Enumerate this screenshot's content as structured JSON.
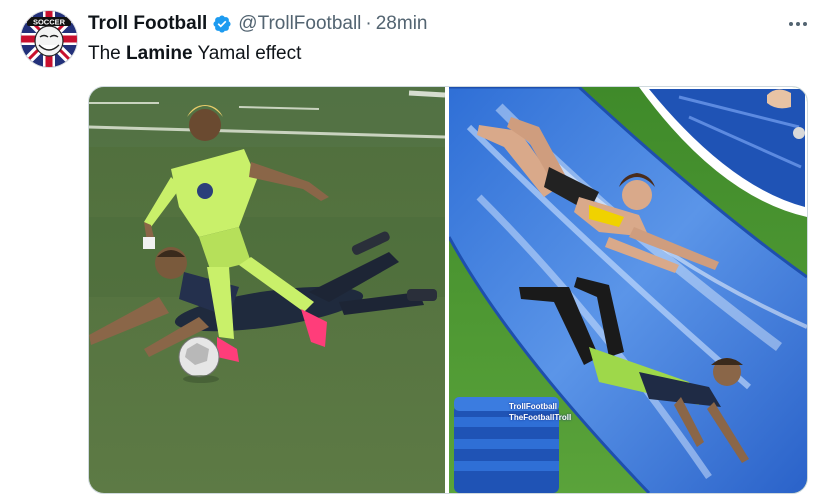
{
  "tweet": {
    "display_name": "Troll Football",
    "handle": "@TrollFootball",
    "separator": "·",
    "time": "28min",
    "text_before": "The ",
    "text_bold": "Lamine",
    "text_after": " Yamal effect",
    "avatar_text": "SOCCER"
  },
  "media": {
    "watermark_line1": "TrollFootball",
    "watermark_line2": "TheFootballTroll"
  },
  "icons": {
    "verified": "verified-badge-icon",
    "more": "more-options-icon"
  },
  "colors": {
    "verified_blue": "#1d9bf0",
    "secondary_text": "#536471",
    "primary_text": "#0f1419"
  }
}
